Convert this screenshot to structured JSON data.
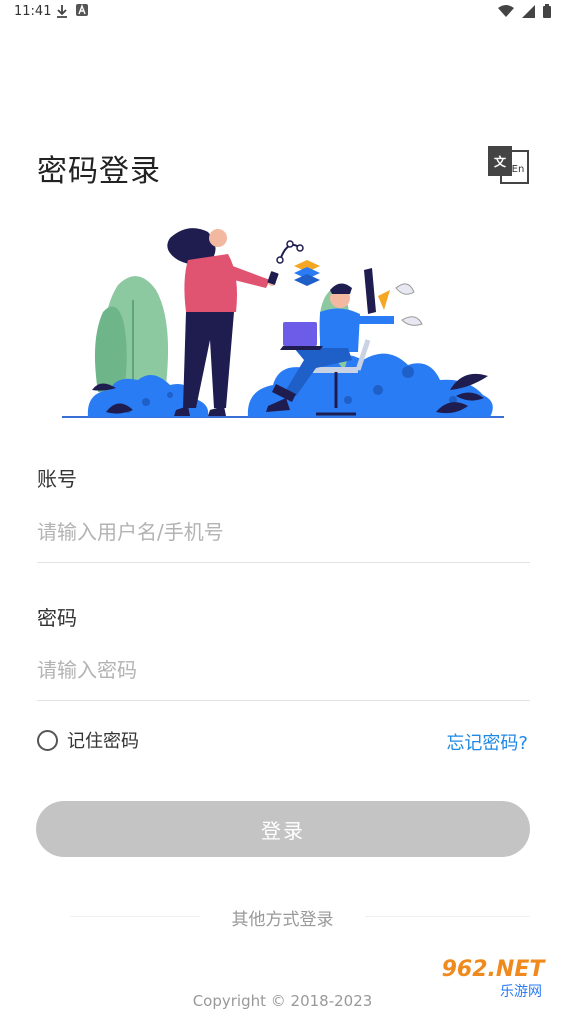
{
  "status_bar": {
    "time": "11:41",
    "left_icons": [
      "download-icon",
      "a-notification-icon"
    ],
    "right_icons": [
      "wifi-icon",
      "signal-icon",
      "battery-icon"
    ]
  },
  "header": {
    "title": "密码登录",
    "lang_icon_text_cn": "文",
    "lang_icon_text_en": "En"
  },
  "form": {
    "account_label": "账号",
    "account_placeholder": "请输入用户名/手机号",
    "account_value": "",
    "password_label": "密码",
    "password_placeholder": "请输入密码",
    "password_value": "",
    "remember_label": "记住密码",
    "remember_checked": false,
    "forgot_label": "忘记密码?"
  },
  "actions": {
    "login_label": "登录",
    "other_login_label": "其他方式登录"
  },
  "footer": {
    "copyright": "Copyright © 2018-2023"
  },
  "watermark": {
    "text_top": "962.NET",
    "text_bottom": "乐游网"
  },
  "colors": {
    "accent_link": "#1e88e5",
    "button_disabled": "#c4c4c4",
    "illustration_blue": "#2a7cf4",
    "illustration_pink": "#e05472",
    "illustration_navy": "#1f1d4f",
    "illustration_green": "#7cc08b"
  }
}
